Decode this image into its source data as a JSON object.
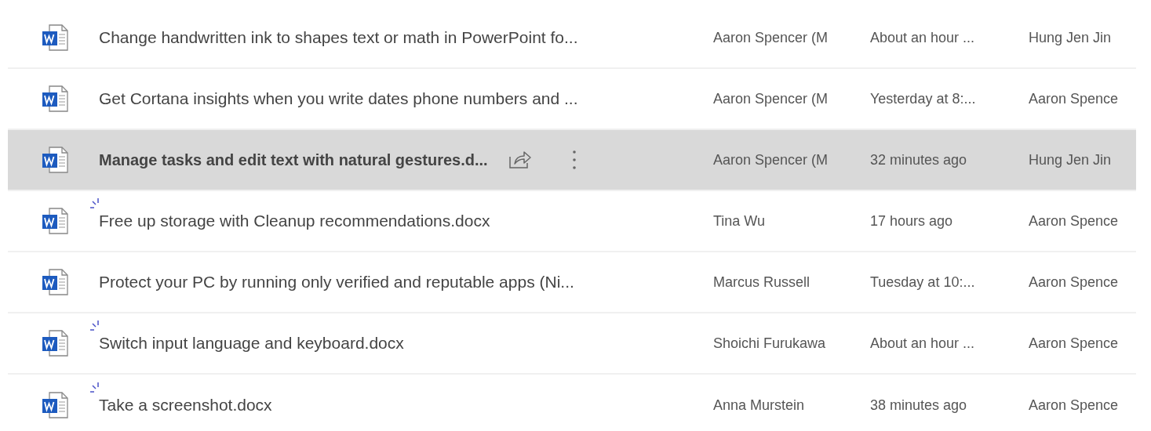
{
  "rows": [
    {
      "name": "Change handwritten ink to shapes text or math in PowerPoint fo...",
      "new": false,
      "selected": false,
      "column_3": "Aaron Spencer (M",
      "column_4": "About an hour ...",
      "column_5": "Hung Jen Jin"
    },
    {
      "name": "Get Cortana insights when you write dates phone numbers and ...",
      "new": false,
      "selected": false,
      "column_3": "Aaron Spencer (M",
      "column_4": "Yesterday at 8:...",
      "column_5": "Aaron Spence"
    },
    {
      "name": "Manage tasks and edit text with natural gestures.d...",
      "new": false,
      "selected": true,
      "column_3": "Aaron Spencer (M",
      "column_4": "32 minutes ago",
      "column_5": "Hung Jen Jin"
    },
    {
      "name": "Free up storage with Cleanup recommendations.docx",
      "new": true,
      "selected": false,
      "column_3": "Tina Wu",
      "column_4": "17 hours ago",
      "column_5": "Aaron Spence"
    },
    {
      "name": "Protect your PC by running only verified and reputable apps (Ni...",
      "new": false,
      "selected": false,
      "column_3": "Marcus Russell",
      "column_4": "Tuesday at 10:...",
      "column_5": "Aaron Spence"
    },
    {
      "name": "Switch input language and keyboard.docx",
      "new": true,
      "selected": false,
      "column_3": "Shoichi Furukawa",
      "column_4": "About an hour ...",
      "column_5": "Aaron Spence"
    },
    {
      "name": "Take a screenshot.docx",
      "new": true,
      "selected": false,
      "column_3": "Anna Murstein",
      "column_4": "38 minutes ago",
      "column_5": "Aaron Spence"
    }
  ]
}
